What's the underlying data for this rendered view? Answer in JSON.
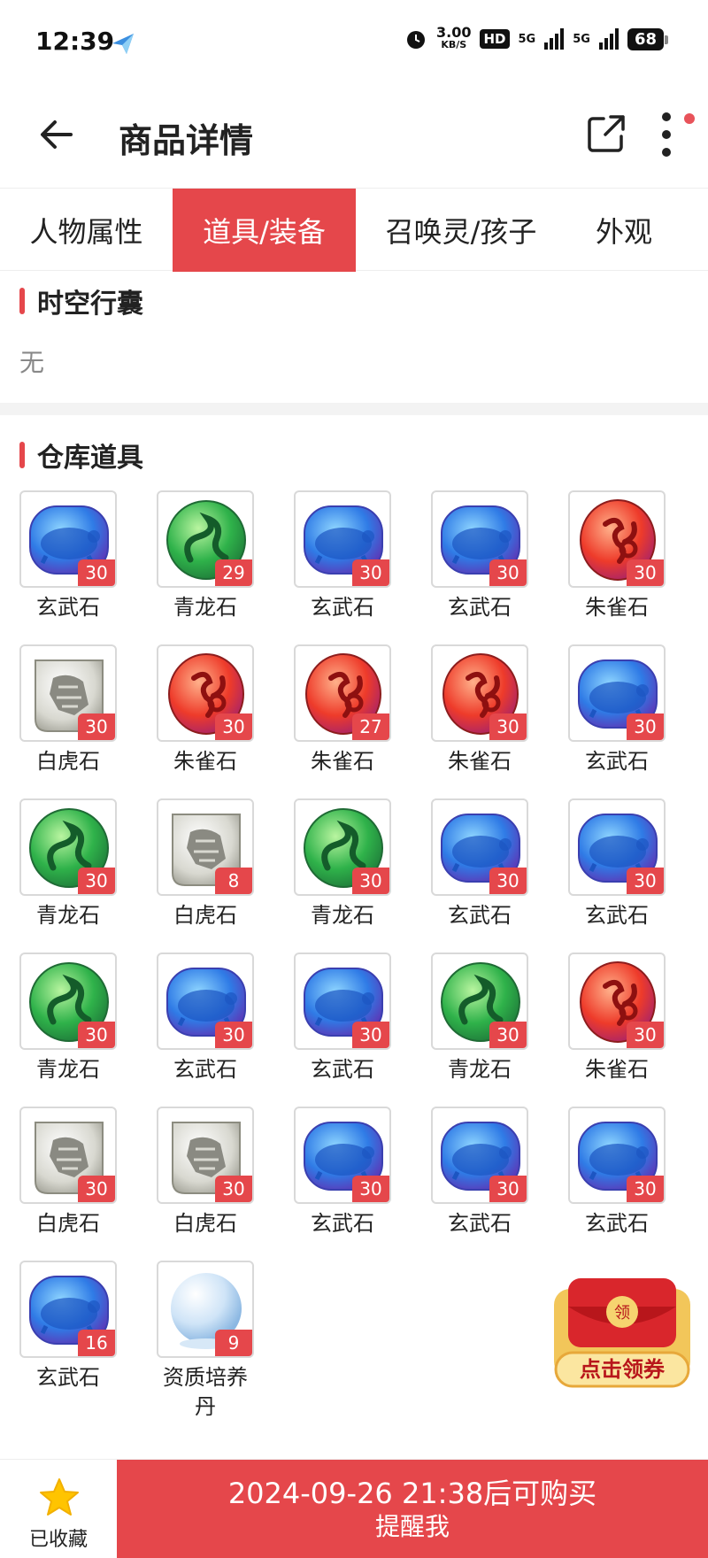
{
  "status": {
    "time": "12:39",
    "net_speed": "3.00",
    "net_unit": "KB/S",
    "hd": "HD",
    "signal1": "5G",
    "signal2": "5G",
    "battery": "68"
  },
  "header": {
    "title": "商品详情"
  },
  "tabs": [
    {
      "label": "人物属性",
      "active": false
    },
    {
      "label": "道具/装备",
      "active": true
    },
    {
      "label": "召唤灵/孩子",
      "active": false
    },
    {
      "label": "外观",
      "active": false
    }
  ],
  "section1": {
    "title": "时空行囊",
    "empty": "无"
  },
  "section2": {
    "title": "仓库道具"
  },
  "items": [
    {
      "name": "玄武石",
      "count": "30",
      "icon": "turtle-stone"
    },
    {
      "name": "青龙石",
      "count": "29",
      "icon": "dragon-stone"
    },
    {
      "name": "玄武石",
      "count": "30",
      "icon": "turtle-stone"
    },
    {
      "name": "玄武石",
      "count": "30",
      "icon": "turtle-stone"
    },
    {
      "name": "朱雀石",
      "count": "30",
      "icon": "phoenix-stone"
    },
    {
      "name": "白虎石",
      "count": "30",
      "icon": "tiger-stone"
    },
    {
      "name": "朱雀石",
      "count": "30",
      "icon": "phoenix-stone"
    },
    {
      "name": "朱雀石",
      "count": "27",
      "icon": "phoenix-stone"
    },
    {
      "name": "朱雀石",
      "count": "30",
      "icon": "phoenix-stone"
    },
    {
      "name": "玄武石",
      "count": "30",
      "icon": "turtle-stone"
    },
    {
      "name": "青龙石",
      "count": "30",
      "icon": "dragon-stone"
    },
    {
      "name": "白虎石",
      "count": "8",
      "icon": "tiger-stone"
    },
    {
      "name": "青龙石",
      "count": "30",
      "icon": "dragon-stone"
    },
    {
      "name": "玄武石",
      "count": "30",
      "icon": "turtle-stone"
    },
    {
      "name": "玄武石",
      "count": "30",
      "icon": "turtle-stone"
    },
    {
      "name": "青龙石",
      "count": "30",
      "icon": "dragon-stone"
    },
    {
      "name": "玄武石",
      "count": "30",
      "icon": "turtle-stone"
    },
    {
      "name": "玄武石",
      "count": "30",
      "icon": "turtle-stone"
    },
    {
      "name": "青龙石",
      "count": "30",
      "icon": "dragon-stone"
    },
    {
      "name": "朱雀石",
      "count": "30",
      "icon": "phoenix-stone"
    },
    {
      "name": "白虎石",
      "count": "30",
      "icon": "tiger-stone"
    },
    {
      "name": "白虎石",
      "count": "30",
      "icon": "tiger-stone"
    },
    {
      "name": "玄武石",
      "count": "30",
      "icon": "turtle-stone"
    },
    {
      "name": "玄武石",
      "count": "30",
      "icon": "turtle-stone"
    },
    {
      "name": "玄武石",
      "count": "30",
      "icon": "turtle-stone"
    },
    {
      "name": "玄武石",
      "count": "16",
      "icon": "turtle-stone"
    },
    {
      "name": "资质培养丹",
      "count": "9",
      "icon": "pearl-orb"
    }
  ],
  "coupon": {
    "label": "点击领券",
    "badge": "领"
  },
  "bottom": {
    "fav_label": "已收藏",
    "buy_line1": "2024-09-26 21:38后可购买",
    "buy_line2": "提醒我"
  },
  "colors": {
    "accent": "#e5474b"
  }
}
